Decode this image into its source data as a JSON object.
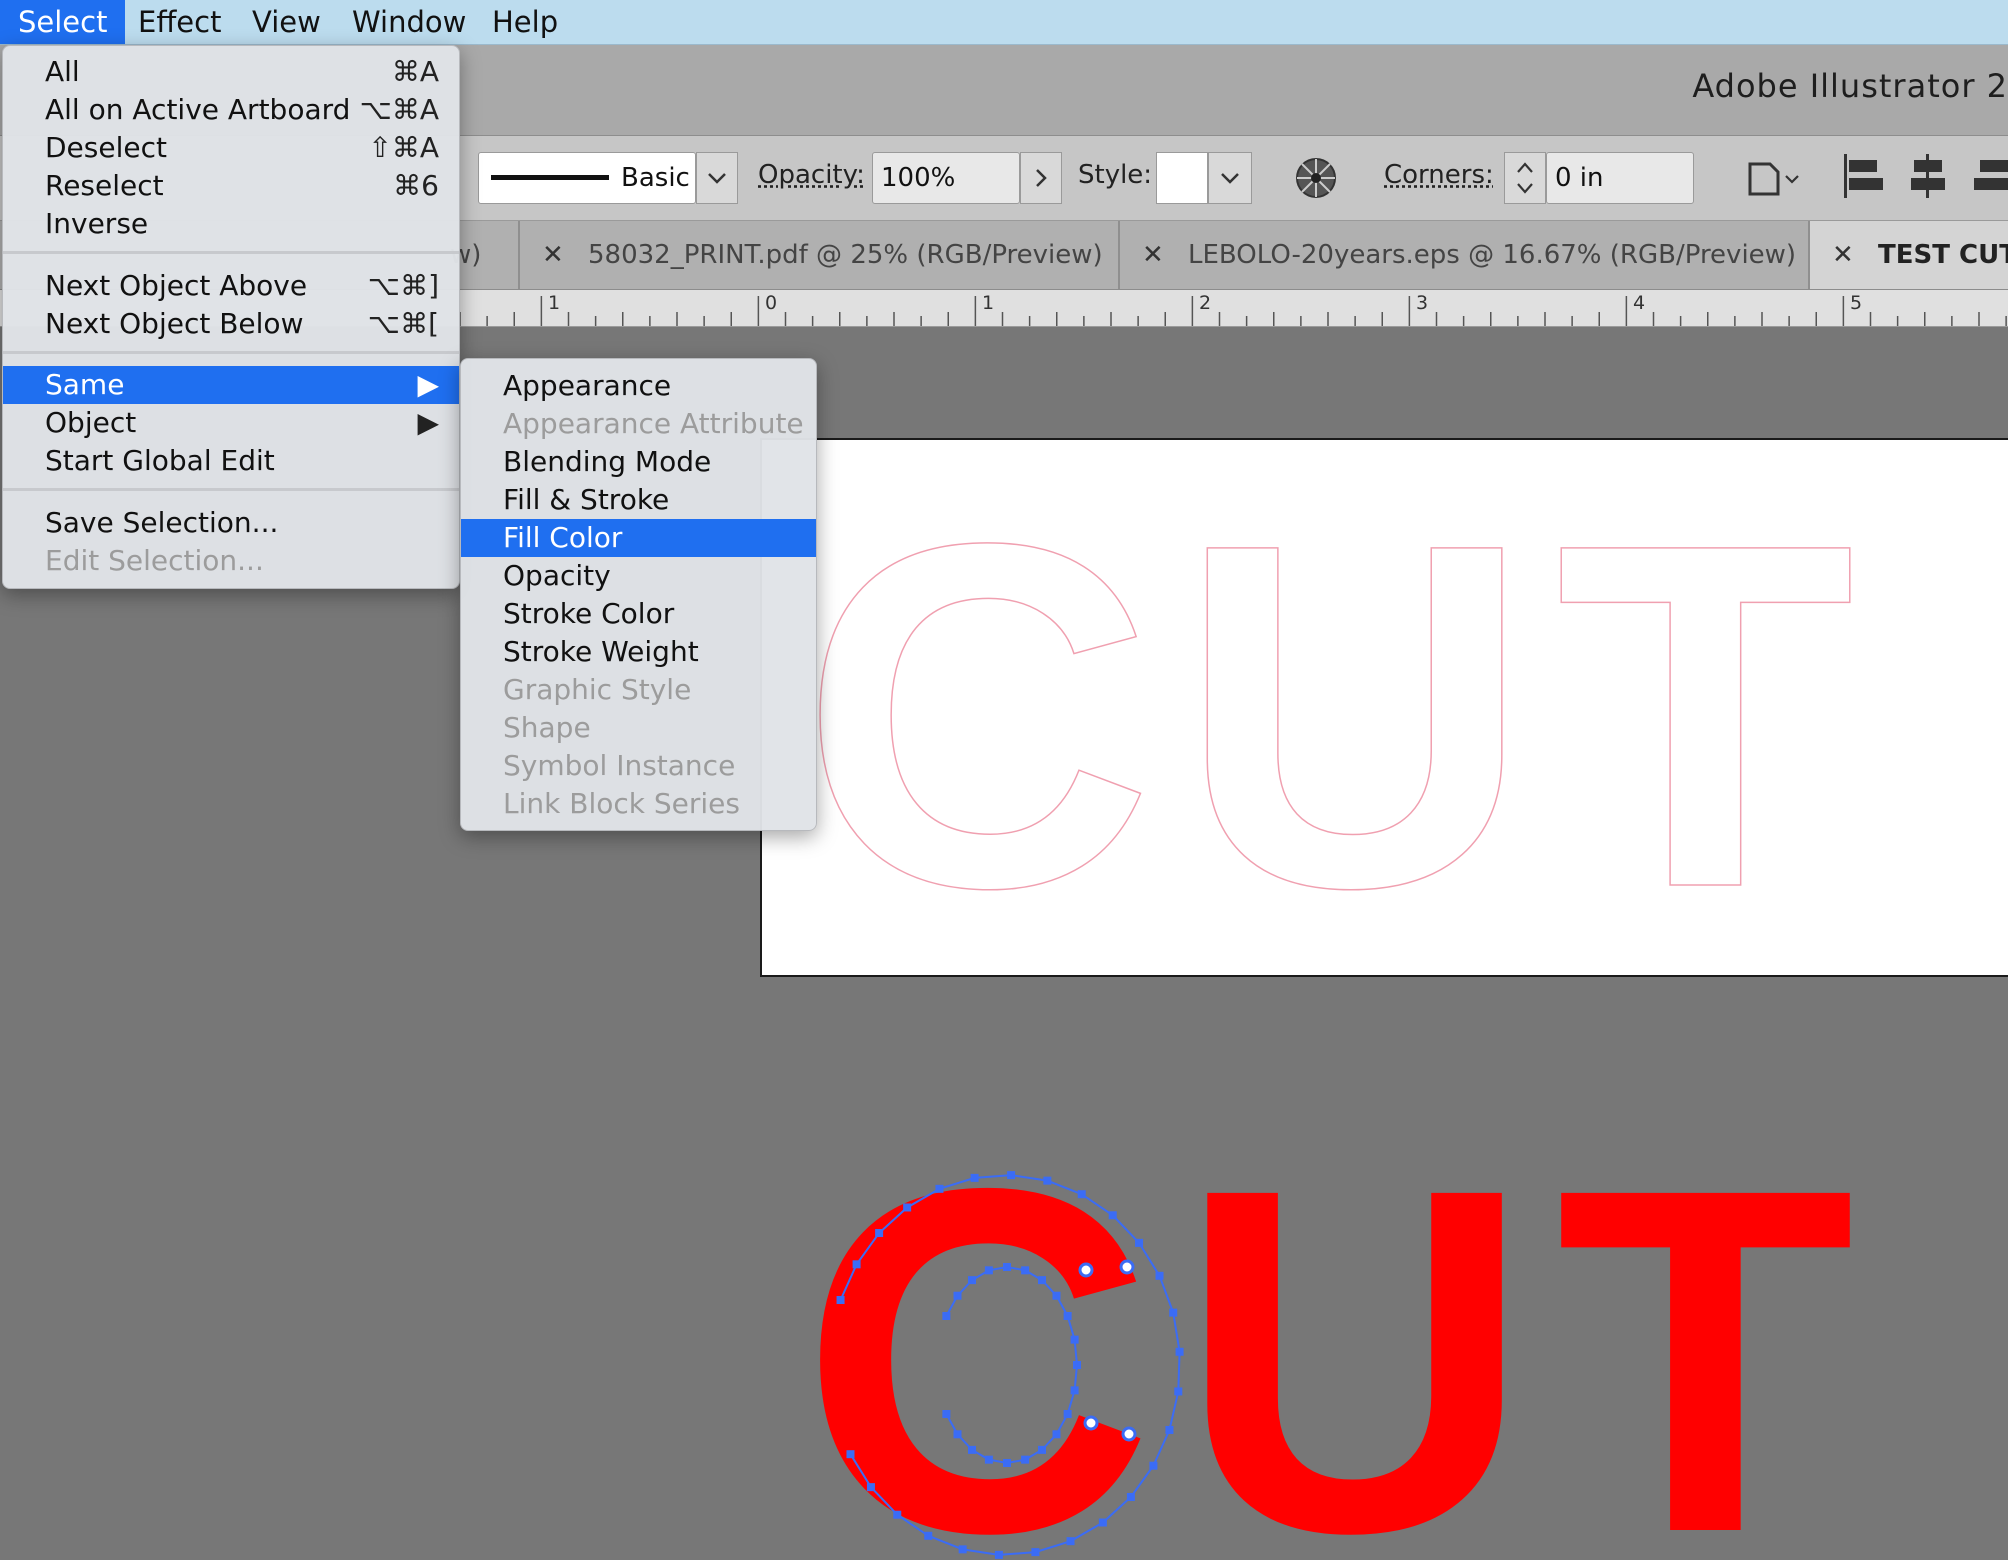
{
  "menubar": {
    "items": [
      "Select",
      "Effect",
      "View",
      "Window",
      "Help"
    ]
  },
  "app_title": "Adobe Illustrator 2",
  "controls": {
    "stroke_profile": "Basic",
    "opacity_label": "Opacity:",
    "opacity_value": "100%",
    "style_label": "Style:",
    "corners_label": "Corners:",
    "corners_value": "0 in"
  },
  "tabs": [
    {
      "label": "w)"
    },
    {
      "label": "58032_PRINT.pdf @ 25% (RGB/Preview)"
    },
    {
      "label": "LEBOLO-20years.eps @ 16.67% (RGB/Preview)"
    },
    {
      "label": "TEST CUT F"
    }
  ],
  "ruler": {
    "labels": [
      "1",
      "0",
      "1",
      "2",
      "3",
      "4",
      "5"
    ]
  },
  "select_menu": {
    "items": [
      {
        "label": "All",
        "shortcut": "⌘A"
      },
      {
        "label": "All on Active Artboard",
        "shortcut": "⌥⌘A"
      },
      {
        "label": "Deselect",
        "shortcut": "⇧⌘A"
      },
      {
        "label": "Reselect",
        "shortcut": "⌘6"
      },
      {
        "label": "Inverse",
        "shortcut": ""
      },
      {
        "label": "Next Object Above",
        "shortcut": "⌥⌘]"
      },
      {
        "label": "Next Object Below",
        "shortcut": "⌥⌘["
      },
      {
        "label": "Same",
        "shortcut": "▶"
      },
      {
        "label": "Object",
        "shortcut": "▶"
      },
      {
        "label": "Start Global Edit",
        "shortcut": ""
      },
      {
        "label": "Save Selection...",
        "shortcut": ""
      },
      {
        "label": "Edit Selection...",
        "shortcut": ""
      }
    ]
  },
  "same_submenu": {
    "items": [
      "Appearance",
      "Appearance Attribute",
      "Blending Mode",
      "Fill & Stroke",
      "Fill Color",
      "Opacity",
      "Stroke Color",
      "Stroke Weight",
      "Graphic Style",
      "Shape",
      "Symbol Instance",
      "Link Block Series"
    ]
  },
  "artwork": {
    "outline_text": "CUT",
    "filled_text": "CUT",
    "fill_color": "#ff0000",
    "outline_color": "#f0a0b0",
    "selection_color": "#3b6cf5"
  },
  "colors": {
    "accent": "#1f6ff0",
    "menubar": "#bcdcee"
  }
}
